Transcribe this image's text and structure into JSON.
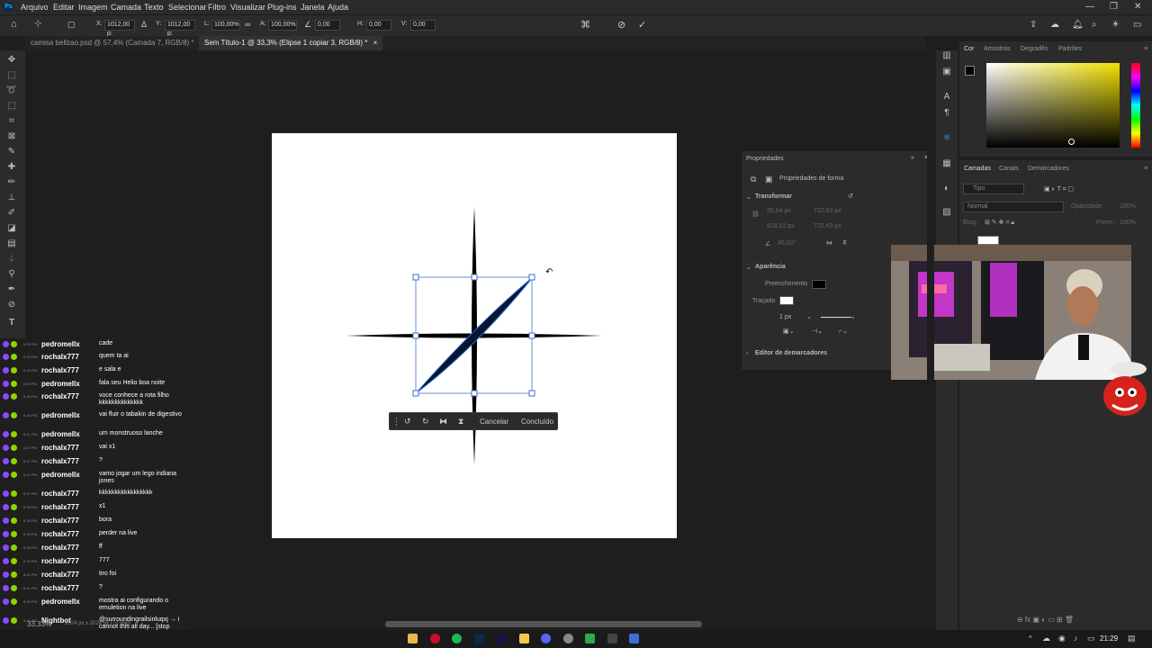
{
  "menubar": {
    "items": [
      "Arquivo",
      "Editar",
      "Imagem",
      "Camada",
      "Texto",
      "Selecionar",
      "Filtro",
      "Visualizar",
      "Plug-ins",
      "Janela",
      "Ajuda"
    ],
    "app_icon": "Ps"
  },
  "options": {
    "x_label": "X:",
    "x_value": "1012,00 p:",
    "y_label": "Y:",
    "y_value": "1012,00 p:",
    "l_label": "L:",
    "l_value": "100,00%",
    "a_label": "A:",
    "a_value": "100,00%",
    "angle_value": "0,00",
    "h_label": "H:",
    "h_value": "0,00",
    "v_label": "V:",
    "v_value": "0,00"
  },
  "tabs": [
    {
      "label": "camisa bellzao.psd @ 57,4% (Camada 7, RGB/8) *"
    },
    {
      "label": "Sem Título-1 @ 33,3% (Elipse 1 copiar 3, RGB/8) *"
    }
  ],
  "context_bar": {
    "cancel": "Cancelar",
    "done": "Concluído"
  },
  "status": {
    "zoom": "33,33%",
    "doc": "2024 px x 2024 px (72 ppp)"
  },
  "color_panel": {
    "tabs": [
      "Cor",
      "Amostras",
      "Degradês",
      "Padrões"
    ],
    "fg": "#000000",
    "bg": "#ffffff"
  },
  "properties": {
    "title": "Propriedades",
    "subtitle": "Propriedades de forma",
    "transform": "Transformar",
    "l_value": "25,64 px",
    "x_value": "722,63 px",
    "a_value": "618,02 px",
    "y_value": "722,63 px",
    "angle": "45,00°",
    "appearance": "Aparência",
    "fill_label": "Preenchimento",
    "stroke_label": "Traçado",
    "stroke_width": "1 px",
    "next_section": "Editor de demarcadores"
  },
  "layers": {
    "tabs": [
      "Camadas",
      "Canais",
      "Demarcadores"
    ],
    "filter": "Tipo",
    "blend": "Normal",
    "opacity_label": "Opacidade:",
    "opacity": "100%",
    "lock_label": "Bloq.:",
    "fill_label": "Preen.:",
    "fill": "100%"
  },
  "chat": [
    {
      "user": "pedromellx",
      "time": "6:29 PM",
      "msg": "cade",
      "ucolor": "#8fd400"
    },
    {
      "user": "rochalx777",
      "time": "6:29 PM",
      "msg": "quem ta ai",
      "ucolor": "#8fd400"
    },
    {
      "user": "rochalx777",
      "time": "6:29 PM",
      "msg": "e sala e",
      "ucolor": "#8fd400"
    },
    {
      "user": "pedromellx",
      "time": "6:29 PM",
      "msg": "fala seu Helio boa noite",
      "ucolor": "#8fd400"
    },
    {
      "user": "rochalx777",
      "time": "6:30 PM",
      "msg": "voce conhece a rota filho kkkkkkkkkkkkkk",
      "ucolor": "#8fd400"
    },
    {
      "user": "pedromellx",
      "time": "6:30 PM",
      "msg": "vai fluir o tabakin de digestivo",
      "ucolor": "#8fd400"
    },
    {
      "user": "pedromellx",
      "time": "6:31 PM",
      "msg": "um monstruoso lanche",
      "ucolor": "#8fd400"
    },
    {
      "user": "rochalx777",
      "time": "6:37 PM",
      "msg": "vai x1",
      "ucolor": "#8fd400"
    },
    {
      "user": "rochalx777",
      "time": "6:37 PM",
      "msg": "?",
      "ucolor": "#8fd400"
    },
    {
      "user": "pedromellx",
      "time": "6:37 PM",
      "msg": "vamo jogar um lego indiana jones",
      "ucolor": "#8fd400"
    },
    {
      "user": "rochalx777",
      "time": "6:37 PM",
      "msg": "kkkkkkkkkkkkkkkkk",
      "ucolor": "#8fd400"
    },
    {
      "user": "rochalx777",
      "time": "6:39 PM",
      "msg": "x1",
      "ucolor": "#8fd400"
    },
    {
      "user": "rochalx777",
      "time": "6:39 PM",
      "msg": "bora",
      "ucolor": "#8fd400"
    },
    {
      "user": "rochalx777",
      "time": "6:39 PM",
      "msg": "perder na live",
      "ucolor": "#8fd400"
    },
    {
      "user": "rochalx777",
      "time": "6:39 PM",
      "msg": "ff",
      "ucolor": "#8fd400"
    },
    {
      "user": "rochalx777",
      "time": "6:39 PM",
      "msg": "777",
      "ucolor": "#8fd400"
    },
    {
      "user": "rochalx777",
      "time": "6:40 PM",
      "msg": "tiro foi",
      "ucolor": "#8fd400"
    },
    {
      "user": "rochalx777",
      "time": "6:40 PM",
      "msg": "?",
      "ucolor": "#8fd400"
    },
    {
      "user": "pedromellx",
      "time": "6:40 PM",
      "msg": "mostra ai configurando o emuletion na live",
      "ucolor": "#8fd400"
    },
    {
      "user": "Nightbot",
      "time": "6:42 PM",
      "msg": "@surroundingrailsinluqxj → i cannot this all day... [stop posting links] [warning]",
      "ucolor": "#8fd400"
    }
  ],
  "taskbar": {
    "time": "21:29"
  }
}
